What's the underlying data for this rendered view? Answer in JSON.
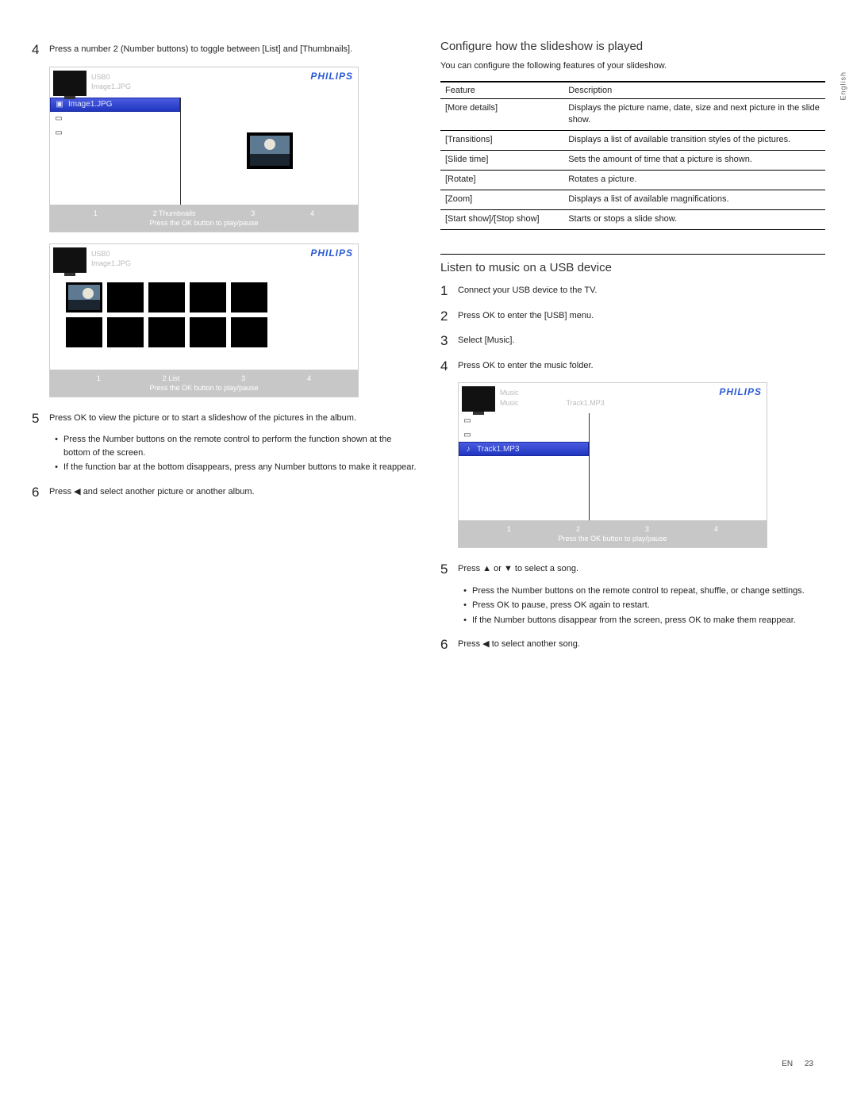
{
  "sideLabel": "English",
  "footer": {
    "lang": "EN",
    "page": "23"
  },
  "left": {
    "step4": "Press a number 2 (Number buttons) to toggle between [List] and [Thumbnails].",
    "step5": "Press OK to view the picture or to start a slideshow of the pictures in the album.",
    "step5_bullets": [
      "Press the Number buttons on the remote control to perform the function shown at the bottom of the screen.",
      "If the function bar at the bottom disappears, press any Number buttons to make it reappear."
    ],
    "step6": "Press ◀ and select another picture or another album."
  },
  "screen1": {
    "title": "USB0",
    "path": "Image1.JPG",
    "brand": "PHILIPS",
    "selected": "Image1.JPG",
    "opts": [
      "1",
      "2  Thumbnails",
      "3",
      "4"
    ],
    "hint": "Press the OK button to play/pause"
  },
  "screen2": {
    "title": "USB0",
    "path": "Image1.JPG",
    "brand": "PHILIPS",
    "opts": [
      "1",
      "2  List",
      "3",
      "4"
    ],
    "hint": "Press the OK button to play/pause"
  },
  "screen3": {
    "title": "Music",
    "path1": "Music",
    "path2": "Track1.MP3",
    "brand": "PHILIPS",
    "selected": "Track1.MP3",
    "opts": [
      "1",
      "2",
      "3",
      "4"
    ],
    "hint": "Press the OK button to play/pause"
  },
  "right": {
    "h_config": "Conﬁgure how the slideshow is played",
    "config_intro": "You can conﬁgure the following features of your slideshow.",
    "table": {
      "head": [
        "Feature",
        "Description"
      ],
      "rows": [
        [
          "[More details]",
          "Displays the picture name, date, size and next picture in the slide show."
        ],
        [
          "[Transitions]",
          "Displays a list of available transition styles of the pictures."
        ],
        [
          "[Slide time]",
          "Sets the amount of time that a picture is shown."
        ],
        [
          "[Rotate]",
          "Rotates a picture."
        ],
        [
          "[Zoom]",
          "Displays a list of available magniﬁcations."
        ],
        [
          "[Start show]/[Stop show]",
          "Starts or stops a slide show."
        ]
      ]
    },
    "h_music": "Listen to music on a USB device",
    "m_step1": "Connect your USB device to the TV.",
    "m_step2": "Press OK to enter the [USB] menu.",
    "m_step3": "Select [Music].",
    "m_step4": "Press OK to enter the music folder.",
    "m_step5": "Press ▲ or ▼ to select a song.",
    "m_step5_bullets": [
      "Press the Number buttons on the remote control to repeat, shufﬂe, or change settings.",
      "Press OK to pause, press OK again to restart.",
      "If the Number buttons disappear from the screen, press OK to make them reappear."
    ],
    "m_step6": "Press ◀ to select another song."
  }
}
